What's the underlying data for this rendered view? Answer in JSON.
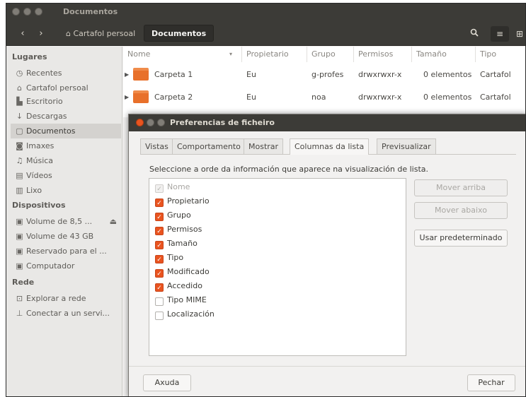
{
  "window": {
    "title": "Documentos"
  },
  "toolbar": {
    "back_icon": "chevron-left-icon",
    "forward_icon": "chevron-right-icon",
    "home_label": "Cartafol persoal",
    "current_label": "Documentos",
    "search_icon": "search-icon",
    "list_view_icon": "list-icon",
    "menu_icon": "menu-icon"
  },
  "sidebar": {
    "places_heading": "Lugares",
    "places": [
      {
        "label": "Recentes",
        "icon": "clock-icon"
      },
      {
        "label": "Cartafol persoal",
        "icon": "home-icon"
      },
      {
        "label": "Escritorio",
        "icon": "desktop-icon"
      },
      {
        "label": "Descargas",
        "icon": "download-icon"
      },
      {
        "label": "Documentos",
        "icon": "document-icon"
      },
      {
        "label": "Imaxes",
        "icon": "camera-icon"
      },
      {
        "label": "Música",
        "icon": "music-icon"
      },
      {
        "label": "Vídeos",
        "icon": "film-icon"
      },
      {
        "label": "Lixo",
        "icon": "trash-icon"
      }
    ],
    "devices_heading": "Dispositivos",
    "devices": [
      {
        "label": "Volume de 8,5 ...",
        "icon": "drive-icon"
      },
      {
        "label": "Volume de 43 GB",
        "icon": "drive-icon"
      },
      {
        "label": "Reservado para el ...",
        "icon": "drive-icon"
      },
      {
        "label": "Computador",
        "icon": "computer-icon"
      }
    ],
    "network_heading": "Rede",
    "network": [
      {
        "label": "Explorar a rede",
        "icon": "network-icon"
      },
      {
        "label": "Conectar a un servi...",
        "icon": "server-icon"
      }
    ]
  },
  "file_list": {
    "columns": [
      "Nome",
      "Propietario",
      "Grupo",
      "Permisos",
      "Tamaño",
      "Tipo"
    ],
    "rows": [
      {
        "name": "Carpeta 1",
        "owner": "Eu",
        "group": "g-profes",
        "perms": "drwxrwxr-x",
        "size": "0 elementos",
        "type": "Cartafol"
      },
      {
        "name": "Carpeta 2",
        "owner": "Eu",
        "group": "noa",
        "perms": "drwxrwxr-x",
        "size": "0 elementos",
        "type": "Cartafol"
      }
    ]
  },
  "dialog": {
    "title": "Preferencias de ficheiro",
    "tabs": [
      "Vistas",
      "Comportamento",
      "Mostrar",
      "Columnas da lista",
      "Previsualizar"
    ],
    "active_tab": "Columnas da lista",
    "instruction": "Seleccione a orde da información que aparece na visualización de lista.",
    "columns": [
      {
        "label": "Nome",
        "checked": true,
        "disabled": true
      },
      {
        "label": "Propietario",
        "checked": true,
        "disabled": false
      },
      {
        "label": "Grupo",
        "checked": true,
        "disabled": false
      },
      {
        "label": "Permisos",
        "checked": true,
        "disabled": false
      },
      {
        "label": "Tamaño",
        "checked": true,
        "disabled": false
      },
      {
        "label": "Tipo",
        "checked": true,
        "disabled": false
      },
      {
        "label": "Modificado",
        "checked": true,
        "disabled": false
      },
      {
        "label": "Accedido",
        "checked": true,
        "disabled": false
      },
      {
        "label": "Tipo MIME",
        "checked": false,
        "disabled": false
      },
      {
        "label": "Localización",
        "checked": false,
        "disabled": false
      }
    ],
    "move_up_label": "Mover arriba",
    "move_down_label": "Mover abaixo",
    "defaults_label": "Usar predeterminado",
    "help_label": "Axuda",
    "close_label": "Pechar"
  },
  "colors": {
    "accent": "#e95420",
    "titlebar": "#3c3b37",
    "folder": "#e8702a"
  }
}
